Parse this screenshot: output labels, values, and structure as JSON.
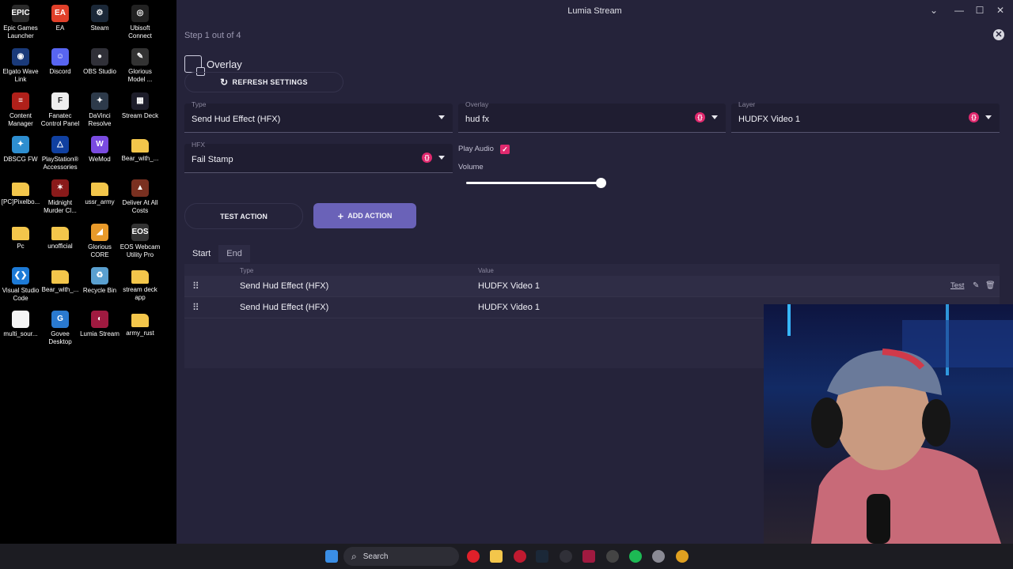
{
  "desktop": {
    "icons": [
      {
        "label": "Epic Games Launcher",
        "icon": "epic-icon",
        "color": "#2a2a2a",
        "glyph": "EPIC"
      },
      {
        "label": "EA",
        "icon": "ea-icon",
        "color": "#e0402a",
        "glyph": "EA"
      },
      {
        "label": "Steam",
        "icon": "steam-icon",
        "color": "#1b2838",
        "glyph": "⚙"
      },
      {
        "label": "Ubisoft Connect",
        "icon": "ubisoft-icon",
        "color": "#222",
        "glyph": "◎"
      },
      {
        "label": "Elgato Wave Link",
        "icon": "wave-link-icon",
        "color": "#1a3a7a",
        "glyph": "◉"
      },
      {
        "label": "Discord",
        "icon": "discord-icon",
        "color": "#5865f2",
        "glyph": "☺"
      },
      {
        "label": "OBS Studio",
        "icon": "obs-icon",
        "color": "#303038",
        "glyph": "●"
      },
      {
        "label": "Glorious Model ...",
        "icon": "glorious-icon",
        "color": "#333",
        "glyph": "✎"
      },
      {
        "label": "Content Manager",
        "icon": "content-manager-icon",
        "color": "#b0201a",
        "glyph": "≡"
      },
      {
        "label": "Fanatec Control Panel",
        "icon": "fanatec-icon",
        "color": "#eeeeee",
        "glyph": "F"
      },
      {
        "label": "DaVinci Resolve",
        "icon": "davinci-icon",
        "color": "#2d3a4a",
        "glyph": "✦"
      },
      {
        "label": "Stream Deck",
        "icon": "stream-deck-icon",
        "color": "#1d1d2a",
        "glyph": "▦"
      },
      {
        "label": "DBSCG FW",
        "icon": "dbscg-icon",
        "color": "#2e8ed0",
        "glyph": "✦"
      },
      {
        "label": "PlayStation® Accessories",
        "icon": "playstation-icon",
        "color": "#1040a0",
        "glyph": "△"
      },
      {
        "label": "WeMod",
        "icon": "wemod-icon",
        "color": "#7a4be0",
        "glyph": "W"
      },
      {
        "label": "Bear_with_...",
        "icon": "folder-icon",
        "color": "#f3c64b",
        "glyph": ""
      },
      {
        "label": "[PC]Pixelbo...",
        "icon": "folder-icon",
        "color": "#f3c64b",
        "glyph": ""
      },
      {
        "label": "Midnight Murder Cl...",
        "icon": "midnight-icon",
        "color": "#8a1a1a",
        "glyph": "✶"
      },
      {
        "label": "ussr_army",
        "icon": "folder-icon",
        "color": "#f3c64b",
        "glyph": ""
      },
      {
        "label": "Deliver At All Costs",
        "icon": "deliver-icon",
        "color": "#7a3020",
        "glyph": "▲"
      },
      {
        "label": "Pc",
        "icon": "folder-icon",
        "color": "#f3c64b",
        "glyph": ""
      },
      {
        "label": "unofficial",
        "icon": "folder-icon",
        "color": "#f3c64b",
        "glyph": ""
      },
      {
        "label": "Glorious CORE",
        "icon": "glorious-core-icon",
        "color": "#e89a2a",
        "glyph": "◢"
      },
      {
        "label": "EOS Webcam Utility Pro",
        "icon": "eos-icon",
        "color": "#333",
        "glyph": "EOS"
      },
      {
        "label": "Visual Studio Code",
        "icon": "vscode-icon",
        "color": "#1d7ad6",
        "glyph": "❮❯"
      },
      {
        "label": "Bear_with_...",
        "icon": "folder-icon",
        "color": "#f3c64b",
        "glyph": ""
      },
      {
        "label": "Recycle Bin",
        "icon": "recycle-bin-icon",
        "color": "#5aa0d0",
        "glyph": "♻"
      },
      {
        "label": "stream deck app",
        "icon": "folder-icon",
        "color": "#f3c64b",
        "glyph": ""
      },
      {
        "label": "multi_sour...",
        "icon": "file-icon",
        "color": "#f4f4f4",
        "glyph": ""
      },
      {
        "label": "Govee Desktop",
        "icon": "govee-icon",
        "color": "#2a7ad0",
        "glyph": "G"
      },
      {
        "label": "Lumia Stream",
        "icon": "lumia-icon",
        "color": "#a01a40",
        "glyph": "◐"
      },
      {
        "label": "army_rust",
        "icon": "folder-icon",
        "color": "#f3c64b",
        "glyph": ""
      }
    ]
  },
  "window": {
    "title": "Lumia Stream",
    "minimize": "⌄",
    "restore": "—",
    "maximize": "☐",
    "close": "✕"
  },
  "dialog": {
    "step": "Step 1 out of 4",
    "close_glyph": "✕",
    "section_title": "Overlay",
    "refresh_label": "REFRESH SETTINGS",
    "refresh_glyph": "↻",
    "fields": {
      "type": {
        "label": "Type",
        "value": "Send Hud Effect (HFX)"
      },
      "overlay": {
        "label": "Overlay",
        "value": "hud fx",
        "badge": "{}"
      },
      "layer": {
        "label": "Layer",
        "value": "HUDFX Video 1",
        "badge": "{}"
      },
      "hfx": {
        "label": "HFX",
        "value": "Fail Stamp",
        "badge": "{}"
      }
    },
    "play_audio": {
      "label": "Play Audio",
      "checked": true,
      "glyph": "✓"
    },
    "volume": {
      "label": "Volume",
      "value": 1.0
    },
    "test_action_label": "TEST ACTION",
    "add_action_label": "ADD ACTION",
    "add_glyph": "+",
    "tabs": [
      {
        "label": "Start",
        "active": true
      },
      {
        "label": "End",
        "active": false
      }
    ],
    "table": {
      "headers": {
        "type": "Type",
        "value": "Value"
      },
      "rows": [
        {
          "type": "Send Hud Effect (HFX)",
          "value": "HUDFX Video 1",
          "test": "Test"
        },
        {
          "type": "Send Hud Effect (HFX)",
          "value": "HUDFX Video 1",
          "test": ""
        }
      ],
      "drag_glyph": "⠿",
      "edit_glyph": "✎",
      "delete_glyph": "🗑"
    }
  },
  "taskbar": {
    "search_label": "Search",
    "search_glyph": "⌕"
  }
}
